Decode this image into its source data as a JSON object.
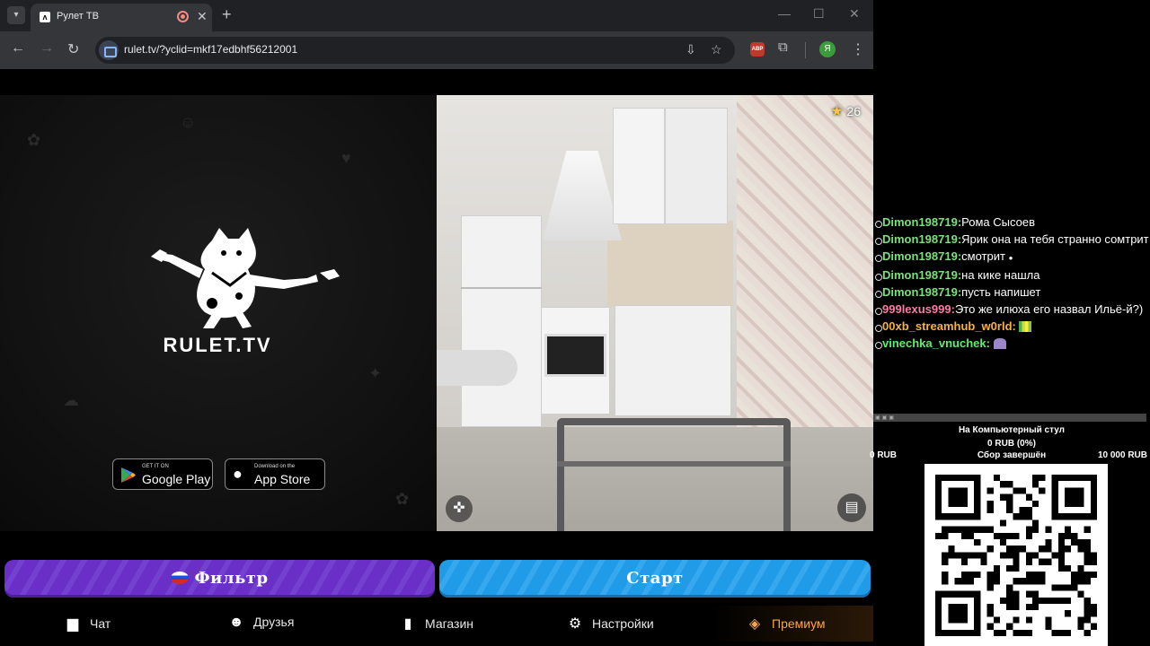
{
  "browser": {
    "tab_title": "Рулет ТВ",
    "tab_favicon": "rulet-favicon",
    "url": "rulet.tv/?yclid=mkf17edbhf56212001",
    "profile_initial": "Я",
    "abp_label": "ABP"
  },
  "hero": {
    "brand": "RULET.TV",
    "google_play_small": "GET IT ON",
    "google_play_big": "Google Play",
    "app_store_small": "Download on the",
    "app_store_big": "App Store"
  },
  "video": {
    "rating": "26"
  },
  "actions": {
    "filter_label": "Фильтр",
    "start_label": "Старт"
  },
  "bottom_nav": {
    "chat": "Чат",
    "friends": "Друзья",
    "shop": "Магазин",
    "settings": "Настройки",
    "premium": "Премиум"
  },
  "chat": {
    "messages": [
      {
        "user": "Dimon198719:",
        "text": "Рома Сысоев"
      },
      {
        "user": "Dimon198719:",
        "text": "Ярик она на тебя странно сомтрит"
      },
      {
        "user": "Dimon198719:",
        "text": "смотрит"
      },
      {
        "user": "Dimon198719:",
        "text": "на кике нашла"
      },
      {
        "user": "Dimon198719:",
        "text": "пусть напишет"
      },
      {
        "user": "999lexus999:",
        "text": "Это же илюха его назвал Ильё-й?)"
      },
      {
        "user": "00xb_streamhub_w0rld:",
        "text": ""
      },
      {
        "user": "vinechka_vnuchek:",
        "text": ""
      }
    ]
  },
  "donation": {
    "title": "На Компьютерный стул",
    "amount": "0 RUB (0%)",
    "progress": 0,
    "min": "0 RUB",
    "status": "Сбор завершён",
    "max": "10 000 RUB"
  },
  "colors": {
    "filter": "#6a2fc7",
    "start": "#1f9be8",
    "premium": "#f4a84c",
    "chat_user_main": "#7be07b",
    "chat_user_alt": "#ff7aa8"
  }
}
